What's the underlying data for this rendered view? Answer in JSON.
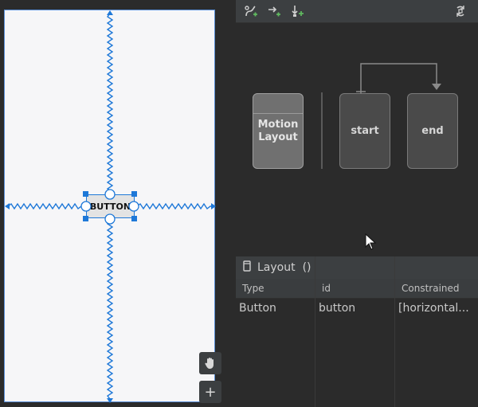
{
  "preview": {
    "widget_label": "BUTTON",
    "tools": {
      "pan_icon": "hand-icon",
      "zoom_in_icon": "plus-icon",
      "zoom_in_label": "+"
    }
  },
  "motion_editor": {
    "toolbar": {
      "icons": [
        "create-constraintset-icon",
        "create-transition-icon",
        "create-click-handler-icon",
        "cycle-icon"
      ]
    },
    "cards": {
      "motion_layout": "Motion\nLayout",
      "start": "start",
      "end": "end"
    }
  },
  "attributes": {
    "title": "Layout",
    "suffix": "()",
    "columns": [
      "Type",
      "id",
      "Constrained"
    ],
    "rows": [
      [
        "Button",
        "button",
        "[horizontal..."
      ]
    ]
  },
  "colors": {
    "accent": "#1e78d8",
    "panel": "#2b2b2b",
    "toolbar": "#3c3f41"
  }
}
